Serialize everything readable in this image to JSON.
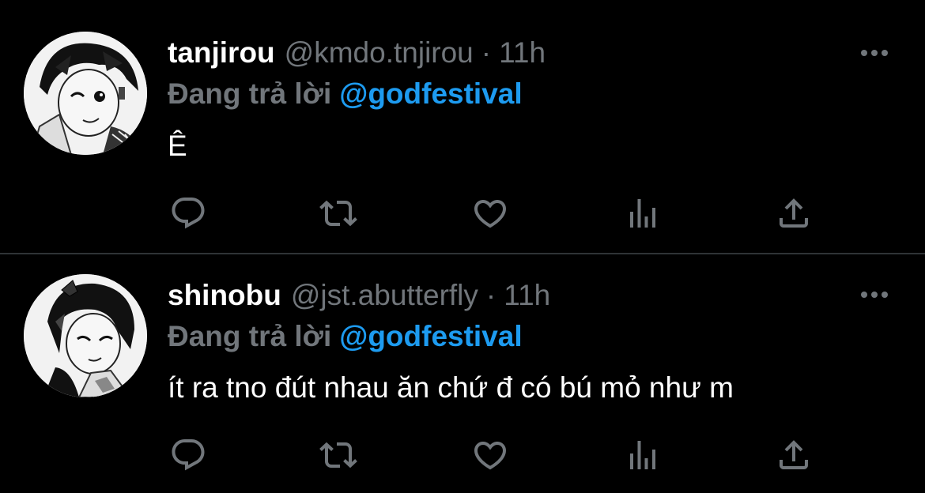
{
  "colors": {
    "background": "#000000",
    "name": "#ffffff",
    "secondary": "#71767b",
    "accent": "#1d9bf0",
    "divider": "#2f3336"
  },
  "tweets": [
    {
      "display_name": "tanjirou",
      "handle": "@kmdo.tnjirou",
      "separator": "·",
      "time": "11h",
      "reply_prefix": "Đang trả lời",
      "reply_to": "@godfestival",
      "text": "Ê",
      "avatar_icon": "avatar-manga-boy-icon",
      "actions": [
        "reply-icon",
        "retweet-icon",
        "like-icon",
        "views-icon",
        "share-icon"
      ]
    },
    {
      "display_name": "shinobu",
      "handle": "@jst.abutterfly",
      "separator": "·",
      "time": "11h",
      "reply_prefix": "Đang trả lời",
      "reply_to": "@godfestival",
      "text": "ít ra tno đút nhau ăn chứ đ có bú mỏ như m",
      "avatar_icon": "avatar-manga-girl-icon",
      "actions": [
        "reply-icon",
        "retweet-icon",
        "like-icon",
        "views-icon",
        "share-icon"
      ]
    }
  ]
}
